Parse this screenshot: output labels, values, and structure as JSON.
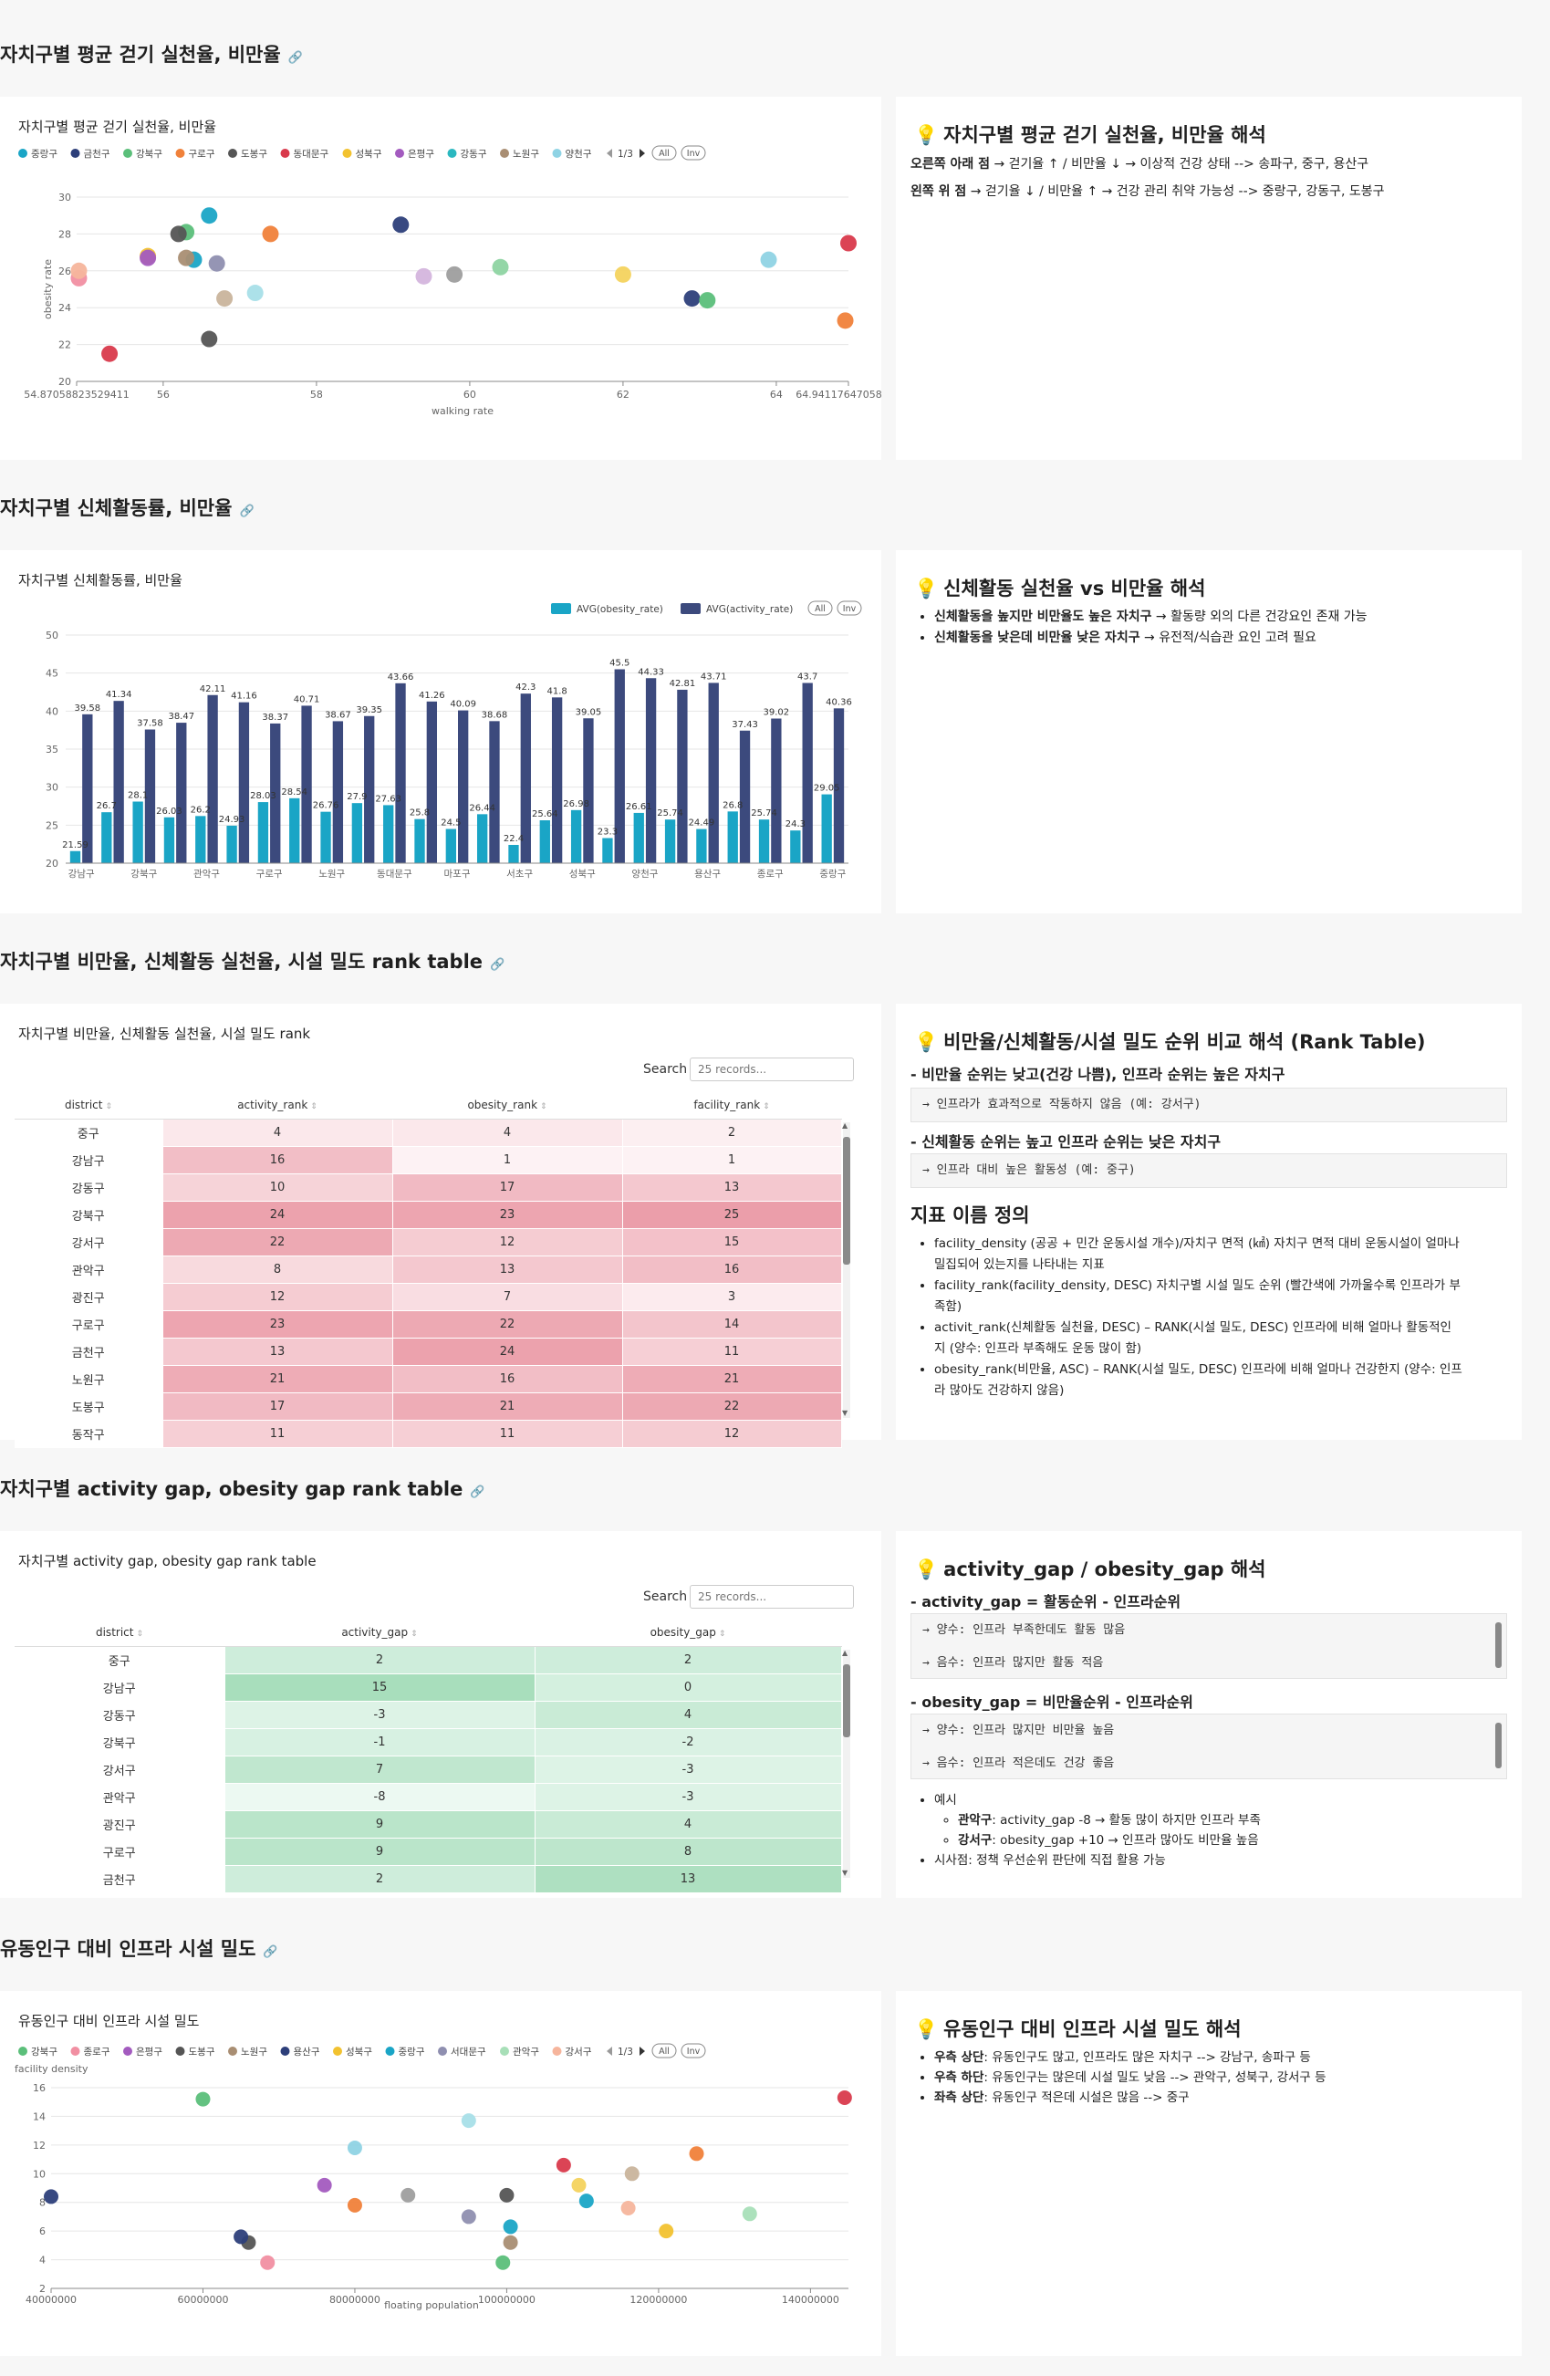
{
  "sections": {
    "s1": {
      "title": "자치구별 평균 걷기 실천율, 비만율",
      "link_icon": "link-icon"
    },
    "s2": {
      "title": "자치구별 신체활동률, 비만율"
    },
    "s3": {
      "title": "자치구별 비만율, 신체활동 실천율, 시설 밀도 rank table"
    },
    "s4": {
      "title": "자치구별 activity gap, obesity gap rank table"
    },
    "s5": {
      "title": "유동인구 대비 인프라 시설 밀도"
    }
  },
  "chart1": {
    "card_title": "자치구별 평균 걷기 실천율, 비만율",
    "legend_page": "1/3",
    "btn_all": "All",
    "btn_inv": "Inv",
    "chart_data": {
      "type": "scatter",
      "xlabel": "walking rate",
      "ylabel": "obesity rate",
      "xlim": [
        54.87058823529411,
        64.94117647058823
      ],
      "ylim": [
        20,
        30
      ],
      "x_ticks": [
        "54.87058823529411",
        "56",
        "58",
        "60",
        "62",
        "64",
        "64.94117647058823"
      ],
      "x_tick_values": [
        54.8706,
        56,
        58,
        60,
        62,
        64,
        64.9412
      ],
      "y_ticks": [
        20,
        22,
        24,
        26,
        28,
        30
      ],
      "legend": [
        "중랑구",
        "금천구",
        "강북구",
        "구로구",
        "도봉구",
        "동대문구",
        "성북구",
        "은평구",
        "강동구",
        "노원구",
        "양천구"
      ],
      "points": [
        {
          "x": 56.6,
          "y": 29.0,
          "c": "#1aa5c6"
        },
        {
          "x": 56.4,
          "y": 26.6,
          "c": "#1aa5c6"
        },
        {
          "x": 59.1,
          "y": 28.5,
          "c": "#2d3f7a"
        },
        {
          "x": 62.9,
          "y": 24.5,
          "c": "#2d3f7a"
        },
        {
          "x": 56.3,
          "y": 28.1,
          "c": "#5bbf7a"
        },
        {
          "x": 63.1,
          "y": 24.4,
          "c": "#5bbf7a"
        },
        {
          "x": 60.4,
          "y": 26.2,
          "c": "#8ed4a2"
        },
        {
          "x": 57.4,
          "y": 28.0,
          "c": "#f0813a"
        },
        {
          "x": 64.9,
          "y": 23.3,
          "c": "#f0813a"
        },
        {
          "x": 56.2,
          "y": 28.0,
          "c": "#555555"
        },
        {
          "x": 56.6,
          "y": 22.3,
          "c": "#555555"
        },
        {
          "x": 59.8,
          "y": 25.8,
          "c": "#9e9e9e"
        },
        {
          "x": 56.3,
          "y": 26.7,
          "c": "#a98e73"
        },
        {
          "x": 56.8,
          "y": 24.5,
          "c": "#c9b49c"
        },
        {
          "x": 55.3,
          "y": 21.5,
          "c": "#d93a4c"
        },
        {
          "x": 65.0,
          "y": 27.5,
          "c": "#d93a4c"
        },
        {
          "x": 55.8,
          "y": 26.8,
          "c": "#f2c230"
        },
        {
          "x": 62.0,
          "y": 25.8,
          "c": "#f4d35e"
        },
        {
          "x": 55.8,
          "y": 26.7,
          "c": "#a35bbf"
        },
        {
          "x": 59.4,
          "y": 25.7,
          "c": "#d4b5dd"
        },
        {
          "x": 56.7,
          "y": 26.4,
          "c": "#8f8fb0"
        },
        {
          "x": 54.9,
          "y": 25.6,
          "c": "#f18fa2"
        },
        {
          "x": 54.9,
          "y": 26.0,
          "c": "#f6b59c"
        },
        {
          "x": 57.2,
          "y": 24.8,
          "c": "#a8dfe8"
        },
        {
          "x": 63.9,
          "y": 26.6,
          "c": "#8fd3e4"
        }
      ]
    }
  },
  "note1": {
    "title": "자치구별 평균 걷기 실천율, 비만율 해석",
    "line1_bold": "오른쪽 아래 점",
    "line1_rest": " → 걷기율 ↑ / 비만율 ↓ → 이상적 건강 상태 --> 송파구, 중구, 용산구",
    "line2_bold": "왼쪽 위 점",
    "line2_rest": " → 걷기율 ↓ / 비만율 ↑ → 건강 관리 취약 가능성 --> 중랑구, 강동구, 도봉구"
  },
  "chart2": {
    "card_title": "자치구별 신체활동률, 비만율",
    "btn_all": "All",
    "btn_inv": "Inv",
    "chart_data": {
      "type": "bar",
      "ylim": [
        20,
        50
      ],
      "y_ticks": [
        20,
        25,
        30,
        35,
        40,
        45,
        50
      ],
      "x_tick_labels": [
        "강남구",
        "강북구",
        "관악구",
        "구로구",
        "노원구",
        "동대문구",
        "마포구",
        "서초구",
        "성북구",
        "양천구",
        "용산구",
        "종로구",
        "중랑구"
      ],
      "series": [
        {
          "name": "AVG(obesity_rate)",
          "color": "#1aa5c6",
          "values": [
            21.59,
            26.7,
            28.1,
            26.03,
            26.2,
            24.93,
            28.03,
            28.54,
            26.76,
            27.9,
            27.63,
            25.8,
            24.5,
            26.44,
            22.4,
            25.64,
            26.98,
            23.3,
            26.61,
            25.74,
            24.49,
            26.8,
            25.74,
            24.3,
            29.05
          ]
        },
        {
          "name": "AVG(activity_rate)",
          "color": "#3c4a7d",
          "values": [
            39.58,
            41.34,
            37.58,
            38.47,
            42.11,
            41.16,
            38.37,
            40.71,
            38.67,
            39.35,
            43.66,
            41.26,
            40.09,
            38.68,
            42.3,
            41.8,
            39.05,
            45.5,
            44.33,
            42.81,
            43.71,
            37.43,
            39.02,
            43.7,
            40.36
          ]
        }
      ],
      "labels_obesity": [
        "21.59",
        "26.7",
        "28.1",
        "26.03",
        "26.2",
        "24.93",
        "28.03",
        "28.54",
        "26.76",
        "27.9",
        "27.63",
        "25.8",
        "24.5",
        "26.44",
        "22.4",
        "25.64",
        "26.98",
        "23.3",
        "26.61",
        "25.74",
        "24.49",
        "26.8",
        "25.74",
        "24.3",
        "29.05"
      ],
      "labels_activity": [
        "39.58",
        "41.34",
        "37.58",
        "38.47",
        "42.11",
        "41.16",
        "38.37",
        "40.71",
        "38.67",
        "39.35",
        "43.66",
        "41.26",
        "40.09",
        "38.68",
        "42.3",
        "41.8",
        "39.05",
        "45.5",
        "44.33",
        "42.81",
        "43.71",
        "37.43",
        "39.02",
        "43.7",
        "40.36"
      ]
    }
  },
  "note2": {
    "title": "신체활동 실천율 vs 비만율 해석",
    "b1_bold": "신체활동을 높지만 비만율도 높은 자치구",
    "b1_rest": " → 활동량 외의 다른 건강요인 존재 가능",
    "b2_bold": "신체활동을 낮은데 비만율 낮은 자치구",
    "b2_rest": " → 유전적/식습관 요인 고려 필요"
  },
  "table1": {
    "card_title": "자치구별 비만율, 신체활동 실천율, 시설 밀도 rank",
    "search_label": "Search",
    "search_placeholder": "25 records...",
    "headers": [
      "district",
      "activity_rank",
      "obesity_rank",
      "facility_rank"
    ],
    "rows": [
      [
        "중구",
        "4",
        "4",
        "2"
      ],
      [
        "강남구",
        "16",
        "1",
        "1"
      ],
      [
        "강동구",
        "10",
        "17",
        "13"
      ],
      [
        "강북구",
        "24",
        "23",
        "25"
      ],
      [
        "강서구",
        "22",
        "12",
        "15"
      ],
      [
        "관악구",
        "8",
        "13",
        "16"
      ],
      [
        "광진구",
        "12",
        "7",
        "3"
      ],
      [
        "구로구",
        "23",
        "22",
        "14"
      ],
      [
        "금천구",
        "13",
        "24",
        "11"
      ],
      [
        "노원구",
        "21",
        "16",
        "21"
      ],
      [
        "도봉구",
        "17",
        "21",
        "22"
      ],
      [
        "동작구",
        "11",
        "11",
        "12"
      ]
    ]
  },
  "note3": {
    "title": "비만율/신체활동/시설 밀도 순위 비교 해석 (Rank Table)",
    "h1": "- 비만율 순위는 낮고(건강 나쁨), 인프라 순위는 높은 자치구",
    "code1": "→ 인프라가 효과적으로 작동하지 않음 (예: 강서구)",
    "h2": "- 신체활동 순위는 높고 인프라 순위는 낮은 자치구",
    "code2": "→ 인프라 대비 높은 활동성 (예: 중구)",
    "h3": "지표 이름 정의",
    "d1a": "facility_density (공공 + 민간 운동시설 개수)/자치구 면적 (㎢) 자치구 면적 대비 운동시설이 얼마나",
    "d1b": "밀집되어 있는지를 나타내는 지표",
    "d2a": "facility_rank(facility_density, DESC) 자치구별 시설 밀도 순위 (빨간색에 가까울수록 인프라가 부",
    "d2b": "족함)",
    "d3a": "activit_rank(신체활동 실천율, DESC) – RANK(시설 밀도, DESC) 인프라에 비해 얼마나 활동적인",
    "d3b": "지 (양수: 인프라 부족해도 운동 많이 함)",
    "d4a": "obesity_rank(비만율, ASC) – RANK(시설 밀도, DESC) 인프라에 비해 얼마나 건강한지 (양수: 인프",
    "d4b": "라 많아도 건강하지 않음)"
  },
  "table2": {
    "card_title": "자치구별 activity gap, obesity gap rank table",
    "search_label": "Search",
    "search_placeholder": "25 records...",
    "headers": [
      "district",
      "activity_gap",
      "obesity_gap"
    ],
    "rows": [
      [
        "중구",
        "2",
        "2"
      ],
      [
        "강남구",
        "15",
        "0"
      ],
      [
        "강동구",
        "-3",
        "4"
      ],
      [
        "강북구",
        "-1",
        "-2"
      ],
      [
        "강서구",
        "7",
        "-3"
      ],
      [
        "관악구",
        "-8",
        "-3"
      ],
      [
        "광진구",
        "9",
        "4"
      ],
      [
        "구로구",
        "9",
        "8"
      ],
      [
        "금천구",
        "2",
        "13"
      ]
    ]
  },
  "note4": {
    "title": "activity_gap / obesity_gap 해석",
    "h1": "- activity_gap = 활동순위 - 인프라순위",
    "c1a": "→ 양수: 인프라 부족한데도 활동 많음",
    "c1b": "→ 음수: 인프라 많지만 활동 적음",
    "h2": "- obesity_gap = 비만율순위 - 인프라순위",
    "c2a": "→ 양수: 인프라 많지만 비만율 높음",
    "c2b": "→ 음수: 인프라 적은데도 건강 좋음",
    "ex": "예시",
    "ex1_bold": "관악구",
    "ex1_rest": ": activity_gap -8 → 활동 많이 하지만 인프라 부족",
    "ex2_bold": "강서구",
    "ex2_rest": ": obesity_gap +10 → 인프라 많아도 비만율 높음",
    "impl": "시사점: 정책 우선순위 판단에 직접 활용 가능"
  },
  "chart5": {
    "card_title": "유동인구 대비 인프라 시설 밀도",
    "legend_page": "1/3",
    "btn_all": "All",
    "btn_inv": "Inv",
    "chart_data": {
      "type": "scatter",
      "xlabel": "floating population",
      "ylabel": "facility density",
      "xlim": [
        40000000,
        145000000
      ],
      "ylim": [
        2,
        16
      ],
      "x_ticks": [
        40000000,
        60000000,
        80000000,
        100000000,
        120000000,
        140000000
      ],
      "y_ticks": [
        2,
        4,
        6,
        8,
        10,
        12,
        14,
        16
      ],
      "legend": [
        "강북구",
        "종로구",
        "은평구",
        "도봉구",
        "노원구",
        "용산구",
        "성북구",
        "중랑구",
        "서대문구",
        "관악구",
        "강서구"
      ],
      "points": [
        {
          "x": 60000000,
          "y": 15.2,
          "c": "#5bbf7a"
        },
        {
          "x": 99500000,
          "y": 3.8,
          "c": "#5bbf7a"
        },
        {
          "x": 68500000,
          "y": 3.8,
          "c": "#f18fa2"
        },
        {
          "x": 76000000,
          "y": 9.2,
          "c": "#a35bbf"
        },
        {
          "x": 66000000,
          "y": 5.2,
          "c": "#555555"
        },
        {
          "x": 100000000,
          "y": 8.5,
          "c": "#555555"
        },
        {
          "x": 100500000,
          "y": 5.2,
          "c": "#a98e73"
        },
        {
          "x": 116500000,
          "y": 10.0,
          "c": "#c9b49c"
        },
        {
          "x": 40000000,
          "y": 8.4,
          "c": "#2d3f7a"
        },
        {
          "x": 65000000,
          "y": 5.6,
          "c": "#2d3f7a"
        },
        {
          "x": 109500000,
          "y": 9.2,
          "c": "#f4d35e"
        },
        {
          "x": 121000000,
          "y": 6.0,
          "c": "#f2c230"
        },
        {
          "x": 100500000,
          "y": 6.3,
          "c": "#1aa5c6"
        },
        {
          "x": 95000000,
          "y": 7.0,
          "c": "#8f8fb0"
        },
        {
          "x": 87000000,
          "y": 8.5,
          "c": "#9e9e9e"
        },
        {
          "x": 95000000,
          "y": 13.7,
          "c": "#a8dfe8"
        },
        {
          "x": 80000000,
          "y": 11.8,
          "c": "#8fd3e4"
        },
        {
          "x": 132000000,
          "y": 7.2,
          "c": "#a8dfb8"
        },
        {
          "x": 116000000,
          "y": 7.6,
          "c": "#f6b59c"
        },
        {
          "x": 80000000,
          "y": 7.8,
          "c": "#f0813a"
        },
        {
          "x": 125000000,
          "y": 11.4,
          "c": "#f0813a"
        },
        {
          "x": 107500000,
          "y": 10.6,
          "c": "#d93a4c"
        },
        {
          "x": 144500000,
          "y": 15.3,
          "c": "#d93a4c"
        },
        {
          "x": 110500000,
          "y": 8.1,
          "c": "#1aa5c6"
        }
      ]
    }
  },
  "note5": {
    "title": "유동인구 대비 인프라 시설 밀도 해석",
    "b1_bold": "우측 상단",
    "b1_rest": ": 유동인구도 많고, 인프라도 많은 자치구 --> 강남구, 송파구 등",
    "b2_bold": "우측 하단",
    "b2_rest": ": 유동인구는 많은데 시설 밀도 낮음 --> 관악구, 성북구, 강서구 등",
    "b3_bold": "좌측 상단",
    "b3_rest": ": 유동인구 적은데 시설은 많음 --> 중구"
  },
  "legend_colors": {
    "중랑구": "#1aa5c6",
    "금천구": "#2d3f7a",
    "강북구": "#5bbf7a",
    "구로구": "#f0813a",
    "도봉구": "#555555",
    "동대문구": "#d93a4c",
    "성북구": "#f2c230",
    "은평구": "#a35bbf",
    "강동구": "#2bb8c0",
    "노원구": "#a98e73",
    "양천구": "#8fd3e4",
    "종로구": "#f18fa2",
    "용산구": "#2d3f7a",
    "서대문구": "#8f8fb0",
    "관악구": "#a8dfb8",
    "강서구": "#f6b59c"
  }
}
